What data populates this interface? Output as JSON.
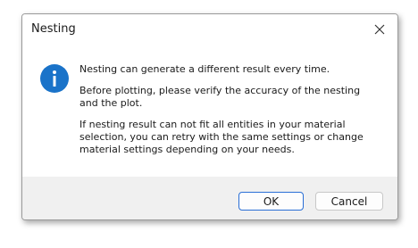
{
  "dialog": {
    "title": "Nesting",
    "icon": "info-icon",
    "messages": [
      "Nesting can generate a different result every time.",
      "Before plotting, please verify the accuracy of the nesting and the plot.",
      "If nesting result can not fit all entities in your material selection, you can retry with the same settings or change material settings depending on your needs."
    ],
    "buttons": {
      "ok_label": "OK",
      "cancel_label": "Cancel"
    },
    "colors": {
      "accent": "#1a73c9",
      "default_button_border": "#2a6fd6"
    }
  }
}
